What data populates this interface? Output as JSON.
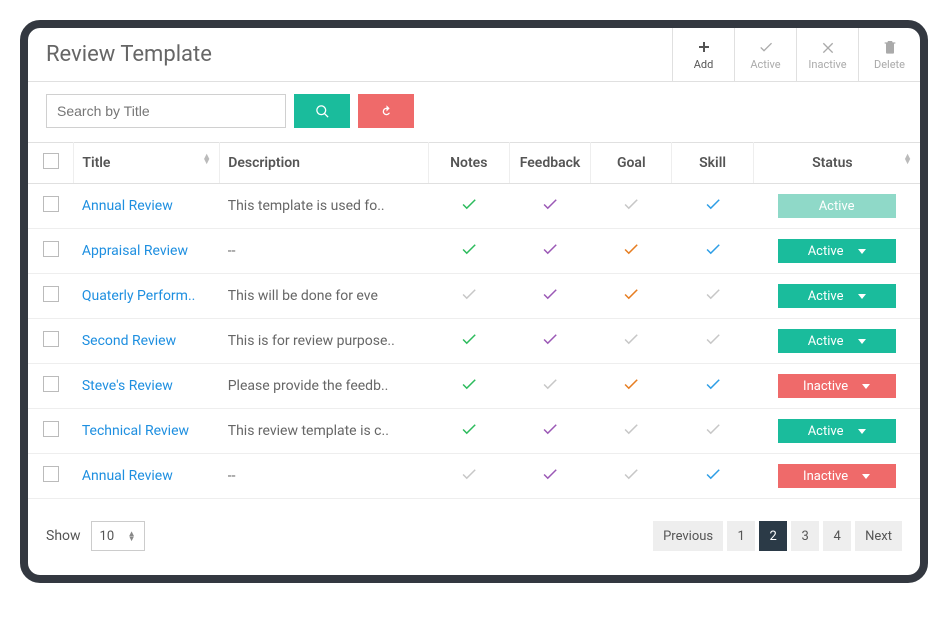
{
  "header": {
    "title": "Review Template",
    "toolbar": {
      "add": "Add",
      "active": "Active",
      "inactive": "Inactive",
      "delete": "Delete"
    }
  },
  "search": {
    "placeholder": "Search by Title"
  },
  "columns": {
    "title": "Title",
    "description": "Description",
    "notes": "Notes",
    "feedback": "Feedback",
    "goal": "Goal",
    "skill": "Skill",
    "status": "Status"
  },
  "rows": [
    {
      "title": "Annual Review",
      "description": "This template is used fo..",
      "notes": "green",
      "feedback": "purple",
      "goal": "gray",
      "skill": "blue",
      "status": "Active",
      "status_style": "light",
      "has_caret": false
    },
    {
      "title": "Appraisal Review",
      "description": "--",
      "notes": "green",
      "feedback": "purple",
      "goal": "orange",
      "skill": "blue",
      "status": "Active",
      "status_style": "active",
      "has_caret": true
    },
    {
      "title": "Quaterly Perform..",
      "description": "This will be done for eve",
      "notes": "gray",
      "feedback": "purple",
      "goal": "orange",
      "skill": "gray",
      "status": "Active",
      "status_style": "active",
      "has_caret": true
    },
    {
      "title": "Second Review",
      "description": "This is for review purpose..",
      "notes": "green",
      "feedback": "purple",
      "goal": "gray",
      "skill": "gray",
      "status": "Active",
      "status_style": "active",
      "has_caret": true
    },
    {
      "title": "Steve's Review",
      "description": "Please provide the feedb..",
      "notes": "green",
      "feedback": "gray",
      "goal": "orange",
      "skill": "blue",
      "status": "Inactive",
      "status_style": "inactive",
      "has_caret": true
    },
    {
      "title": "Technical Review",
      "description": "This review template is c..",
      "notes": "green",
      "feedback": "purple",
      "goal": "gray",
      "skill": "gray",
      "status": "Active",
      "status_style": "active",
      "has_caret": true
    },
    {
      "title": "Annual Review",
      "description": "--",
      "notes": "gray",
      "feedback": "purple",
      "goal": "gray",
      "skill": "blue",
      "status": "Inactive",
      "status_style": "inactive",
      "has_caret": true
    }
  ],
  "footer": {
    "show_label": "Show",
    "page_size": "10",
    "prev": "Previous",
    "next": "Next",
    "pages": [
      "1",
      "2",
      "3",
      "4"
    ],
    "current_page": "2"
  }
}
